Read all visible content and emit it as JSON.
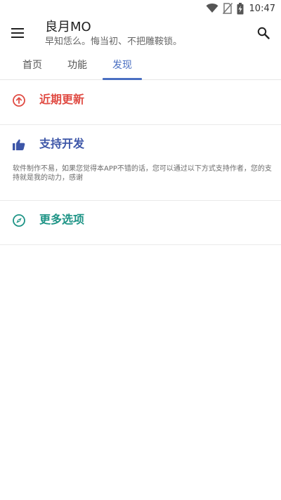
{
  "status_bar": {
    "time": "10:47",
    "icons": [
      "wifi-icon",
      "no-sim-icon",
      "battery-charging-icon"
    ]
  },
  "app_bar": {
    "title": "良月MO",
    "subtitle": "早知恁么。悔当初、不把雕鞍锁。",
    "menu_icon": "menu-icon",
    "search_icon": "search-icon"
  },
  "tabs": [
    {
      "label": "首页",
      "selected": false
    },
    {
      "label": "功能",
      "selected": false
    },
    {
      "label": "发现",
      "selected": true
    }
  ],
  "sections": {
    "recent_updates": {
      "title": "近期更新",
      "icon": "arrow-up-circle-icon",
      "color": "#e04b43"
    },
    "support_dev": {
      "title": "支持开发",
      "icon": "thumbs-up-icon",
      "color": "#3d56a8",
      "description": "软件制作不易，如果您觉得本APP不错的话，您可以通过以下方式支持作者，您的支持就是我的动力，感谢"
    },
    "more_options": {
      "title": "更多选项",
      "icon": "compass-icon",
      "color": "#1e9486"
    }
  },
  "colors": {
    "accent": "#4a6fc2",
    "background": "#ffffff"
  }
}
